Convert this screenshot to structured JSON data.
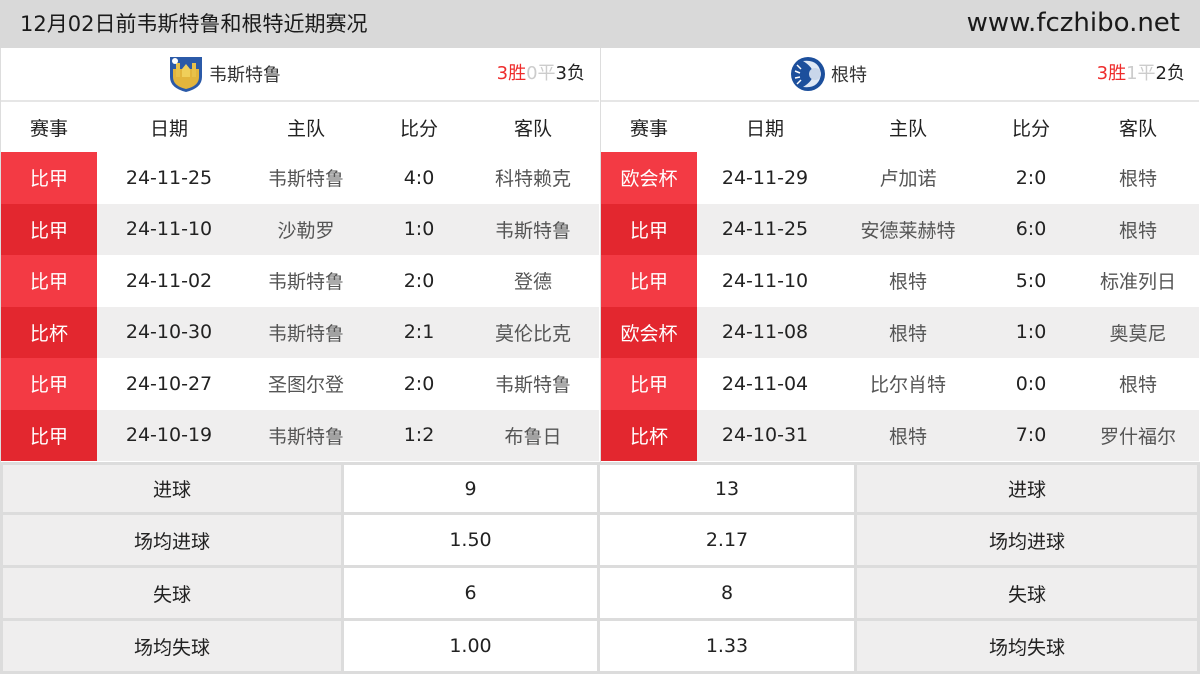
{
  "header": {
    "title": "12月02日前韦斯特鲁和根特近期赛况",
    "site": "www.fczhibo.net"
  },
  "columns": [
    "赛事",
    "日期",
    "主队",
    "比分",
    "客队"
  ],
  "teams": [
    {
      "name": "韦斯特鲁",
      "logo_icon": "westerlo-crest-icon",
      "record": {
        "win": "3胜",
        "draw": "0平",
        "loss": "3负"
      },
      "matches": [
        {
          "comp": "比甲",
          "date": "24-11-25",
          "home": "韦斯特鲁",
          "score": "4:0",
          "away": "科特赖克"
        },
        {
          "comp": "比甲",
          "date": "24-11-10",
          "home": "沙勒罗",
          "score": "1:0",
          "away": "韦斯特鲁"
        },
        {
          "comp": "比甲",
          "date": "24-11-02",
          "home": "韦斯特鲁",
          "score": "2:0",
          "away": "登德"
        },
        {
          "comp": "比杯",
          "date": "24-10-30",
          "home": "韦斯特鲁",
          "score": "2:1",
          "away": "莫伦比克"
        },
        {
          "comp": "比甲",
          "date": "24-10-27",
          "home": "圣图尔登",
          "score": "2:0",
          "away": "韦斯特鲁"
        },
        {
          "comp": "比甲",
          "date": "24-10-19",
          "home": "韦斯特鲁",
          "score": "1:2",
          "away": "布鲁日"
        }
      ]
    },
    {
      "name": "根特",
      "logo_icon": "gent-crest-icon",
      "record": {
        "win": "3胜",
        "draw": "1平",
        "loss": "2负"
      },
      "matches": [
        {
          "comp": "欧会杯",
          "date": "24-11-29",
          "home": "卢加诺",
          "score": "2:0",
          "away": "根特"
        },
        {
          "comp": "比甲",
          "date": "24-11-25",
          "home": "安德莱赫特",
          "score": "6:0",
          "away": "根特"
        },
        {
          "comp": "比甲",
          "date": "24-11-10",
          "home": "根特",
          "score": "5:0",
          "away": "标准列日"
        },
        {
          "comp": "欧会杯",
          "date": "24-11-08",
          "home": "根特",
          "score": "1:0",
          "away": "奥莫尼"
        },
        {
          "comp": "比甲",
          "date": "24-11-04",
          "home": "比尔肖特",
          "score": "0:0",
          "away": "根特"
        },
        {
          "comp": "比杯",
          "date": "24-10-31",
          "home": "根特",
          "score": "7:0",
          "away": "罗什福尔"
        }
      ]
    }
  ],
  "stats": [
    {
      "label": "进球",
      "left": "9",
      "right": "13"
    },
    {
      "label": "场均进球",
      "left": "1.50",
      "right": "2.17"
    },
    {
      "label": "失球",
      "left": "6",
      "right": "8"
    },
    {
      "label": "场均失球",
      "left": "1.00",
      "right": "1.33"
    }
  ],
  "colors": {
    "comp_bg": "#f33a44",
    "comp_bg_alt": "#e3272f",
    "win": "#ee2b2b",
    "draw": "#cccccc"
  }
}
